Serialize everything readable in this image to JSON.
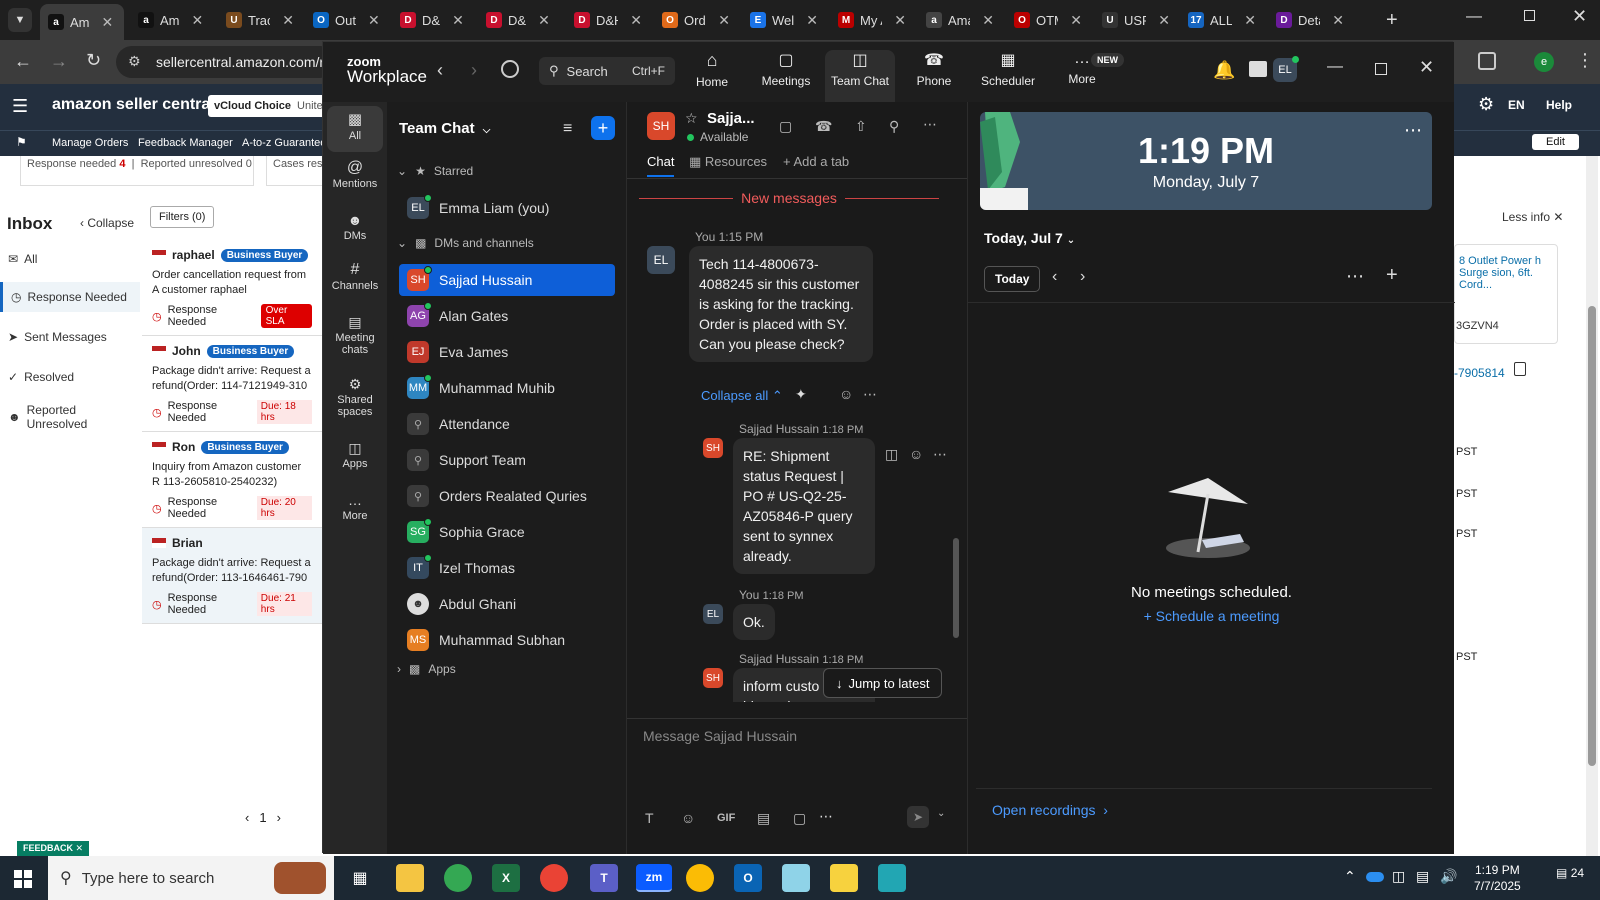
{
  "browser": {
    "tabs": [
      {
        "label": "Am",
        "fav": "a",
        "color": "#111"
      },
      {
        "label": "Am",
        "fav": "a",
        "color": "#111"
      },
      {
        "label": "Trac",
        "fav": "U",
        "color": "#7a4b1e"
      },
      {
        "label": "Out",
        "fav": "O",
        "color": "#0a66c2"
      },
      {
        "label": "D&",
        "fav": "D",
        "color": "#c8102e"
      },
      {
        "label": "D&",
        "fav": "D",
        "color": "#c8102e"
      },
      {
        "label": "D&H Di",
        "fav": "D",
        "color": "#c8102e"
      },
      {
        "label": "Orders",
        "fav": "O",
        "color": "#e06a1a"
      },
      {
        "label": "Welcom",
        "fav": "E",
        "color": "#1a73e8"
      },
      {
        "label": "My Acc",
        "fav": "M",
        "color": "#b00"
      },
      {
        "label": "Amazon",
        "fav": "a",
        "color": "#444"
      },
      {
        "label": "OTMS",
        "fav": "O",
        "color": "#b00"
      },
      {
        "label": "USPS.cc",
        "fav": "U",
        "color": "#333"
      },
      {
        "label": "ALL-IN-",
        "fav": "17",
        "color": "#1565c0"
      },
      {
        "label": "Detailed",
        "fav": "D",
        "color": "#6a1b9a"
      }
    ],
    "url": "sellercentral.amazon.com/r"
  },
  "amazon": {
    "logo": "amazon seller central",
    "store": "vCloud Choice",
    "store_region": "Unite",
    "lang": "EN",
    "help": "Help",
    "nav": [
      "Manage Orders",
      "Feedback Manager",
      "A-to-z Guarantee"
    ],
    "edit": "Edit",
    "response_needed_label": "Response needed",
    "response_needed_count": "4",
    "reported_unresolved_label": "Reported unresolved",
    "reported_unresolved_count": "0",
    "cases_label": "Cases res",
    "inbox_title": "Inbox",
    "collapse": "Collapse",
    "filters": "Filters (0)",
    "folders": [
      "All",
      "Response Needed",
      "Sent Messages",
      "Resolved",
      "Reported Unresolved"
    ],
    "messages": [
      {
        "name": "raphael",
        "badge": "Business Buyer",
        "text": "Order cancellation request from A customer raphael",
        "status": "Response Needed",
        "tag": "Over SLA"
      },
      {
        "name": "John",
        "badge": "Business Buyer",
        "text": "Package didn't arrive: Request a refund(Order: 114-7121949-310",
        "status": "Response Needed",
        "tag": "Due: 18 hrs"
      },
      {
        "name": "Ron",
        "badge": "Business Buyer",
        "text": "Inquiry from Amazon customer R 113-2605810-2540232)",
        "status": "Response Needed",
        "tag": "Due: 20 hrs"
      },
      {
        "name": "Brian",
        "badge": "",
        "text": "Package didn't arrive: Request a refund(Order: 113-1646461-790",
        "status": "Response Needed",
        "tag": "Due: 21 hrs"
      }
    ],
    "page": "1",
    "less_info": "Less info",
    "right_product": "8 Outlet Power h Surge sion, 6ft. Cord...",
    "right_asin": "3GZVN4",
    "right_order": "-7905814",
    "pst": "PST",
    "feedback": "FEEDBACK"
  },
  "zoom": {
    "brand_top": "zoom",
    "brand_bottom": "Workplace",
    "search": "Search",
    "search_shortcut": "Ctrl+F",
    "tabs": [
      "Home",
      "Meetings",
      "Team Chat",
      "Phone",
      "Scheduler",
      "More"
    ],
    "new_badge": "NEW",
    "user_initials": "EL",
    "rail": [
      "All",
      "Mentions",
      "DMs",
      "Channels",
      "Meeting chats",
      "Shared spaces",
      "Apps",
      "More"
    ],
    "list_title": "Team Chat",
    "starred": "Starred",
    "dms_channels": "DMs and channels",
    "apps": "Apps",
    "contacts": [
      {
        "name": "Emma Liam (you)",
        "init": "EL",
        "color": "#3b4a5a"
      },
      {
        "name": "Sajjad Hussain",
        "init": "SH",
        "color": "#d9482b"
      },
      {
        "name": "Alan Gates",
        "init": "AG",
        "color": "#8e44ad"
      },
      {
        "name": "Eva James",
        "init": "EJ",
        "color": "#c0392b"
      },
      {
        "name": "Muhammad Muhib",
        "init": "MM",
        "color": "#2e86c1"
      },
      {
        "name": "Attendance",
        "init": "",
        "color": "#3a3a3a"
      },
      {
        "name": "Support Team",
        "init": "",
        "color": "#3a3a3a"
      },
      {
        "name": "Orders Realated Quries",
        "init": "",
        "color": "#3a3a3a"
      },
      {
        "name": "Sophia Grace",
        "init": "SG",
        "color": "#27ae60"
      },
      {
        "name": "Izel Thomas",
        "init": "IT",
        "color": "#34495e"
      },
      {
        "name": "Abdul Ghani",
        "init": "",
        "color": "#eee"
      },
      {
        "name": "Muhammad Subhan",
        "init": "MS",
        "color": "#e67e22"
      }
    ],
    "chat": {
      "name": "Sajja...",
      "status": "Available",
      "initials": "SH",
      "tabs": [
        "Chat",
        "Resources",
        "Add a tab"
      ],
      "new_messages": "New messages",
      "messages": [
        {
          "from": "You",
          "time": "1:15 PM",
          "text": "Tech 114-4800673-4088245 sir this customer is asking for the tracking. Order is placed with SY. Can you please check?"
        },
        {
          "from": "Sajjad Hussain",
          "time": "1:18 PM",
          "text": "RE: Shipment status Request | PO # US-Q2-25-AZ05846-P query sent to synnex already."
        },
        {
          "from": "You",
          "time": "1:18 PM",
          "text": "Ok."
        },
        {
          "from": "Sajjad Hussain",
          "time": "1:18 PM",
          "text": "inform custo that his package"
        }
      ],
      "collapse_all": "Collapse all",
      "jump": "Jump to latest",
      "input_placeholder": "Message Sajjad Hussain",
      "gif": "GIF"
    },
    "calendar": {
      "time": "1:19 PM",
      "date": "Monday, July 7",
      "today_label": "Today, Jul 7",
      "today_btn": "Today",
      "empty": "No meetings scheduled.",
      "schedule": "Schedule a meeting",
      "recordings": "Open recordings"
    }
  },
  "taskbar": {
    "search": "Type here to search",
    "time": "1:19 PM",
    "date": "7/7/2025",
    "notif": "24"
  }
}
